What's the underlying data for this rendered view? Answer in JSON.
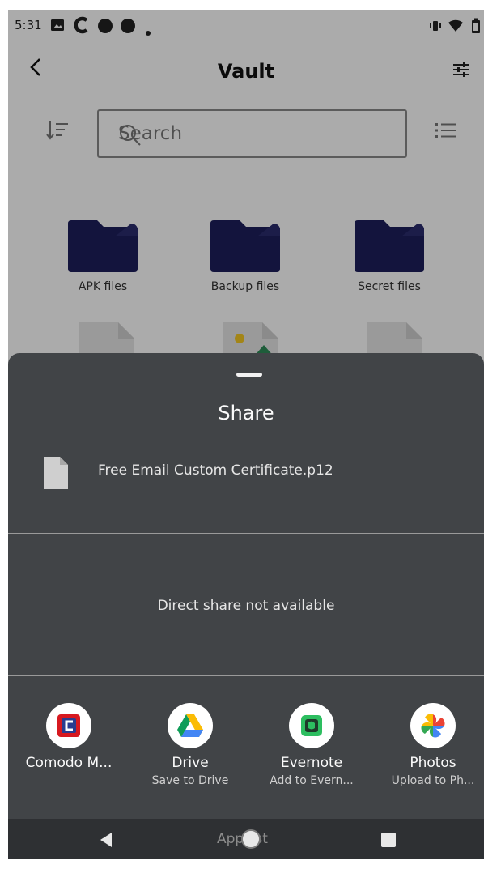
{
  "status_bar": {
    "time": "5:31",
    "icons": [
      "image-icon",
      "c-app-icon",
      "dot-icon",
      "dot-icon",
      "small-dot-icon",
      "vibrate-icon",
      "wifi-icon",
      "battery-icon"
    ]
  },
  "toolbar": {
    "back_icon": "back-arrow-icon",
    "title": "Vault",
    "filter_icon": "filter-sliders-icon"
  },
  "search": {
    "placeholder": "Search",
    "sort_icon": "sort-icon",
    "search_icon": "search-icon",
    "view_icon": "list-view-icon"
  },
  "folders": [
    {
      "name": "APK files"
    },
    {
      "name": "Backup files"
    },
    {
      "name": "Secret files"
    }
  ],
  "share_sheet": {
    "title": "Share",
    "file_name": "Free Email Custom Certificate.p12",
    "direct_share_text": "Direct share not available",
    "targets": [
      {
        "label": "Comodo M...",
        "sublabel": "",
        "icon": "comodo-icon"
      },
      {
        "label": "Drive",
        "sublabel": "Save to Drive",
        "icon": "google-drive-icon"
      },
      {
        "label": "Evernote",
        "sublabel": "Add to Evern...",
        "icon": "evernote-icon"
      },
      {
        "label": "Photos",
        "sublabel": "Upload to Ph...",
        "icon": "google-photos-icon"
      }
    ]
  },
  "nav_bar": {
    "label": "AppList",
    "back_icon": "nav-back-icon",
    "home_icon": "nav-home-icon",
    "recent_icon": "nav-recent-icon"
  },
  "colors": {
    "folder": "#1d1f5c",
    "folder_tab": "#2a2c6e",
    "sheet_bg": "#414447",
    "nav_bg": "#2e3033",
    "comodo_red": "#d71920",
    "evernote_green": "#2dbe60"
  }
}
